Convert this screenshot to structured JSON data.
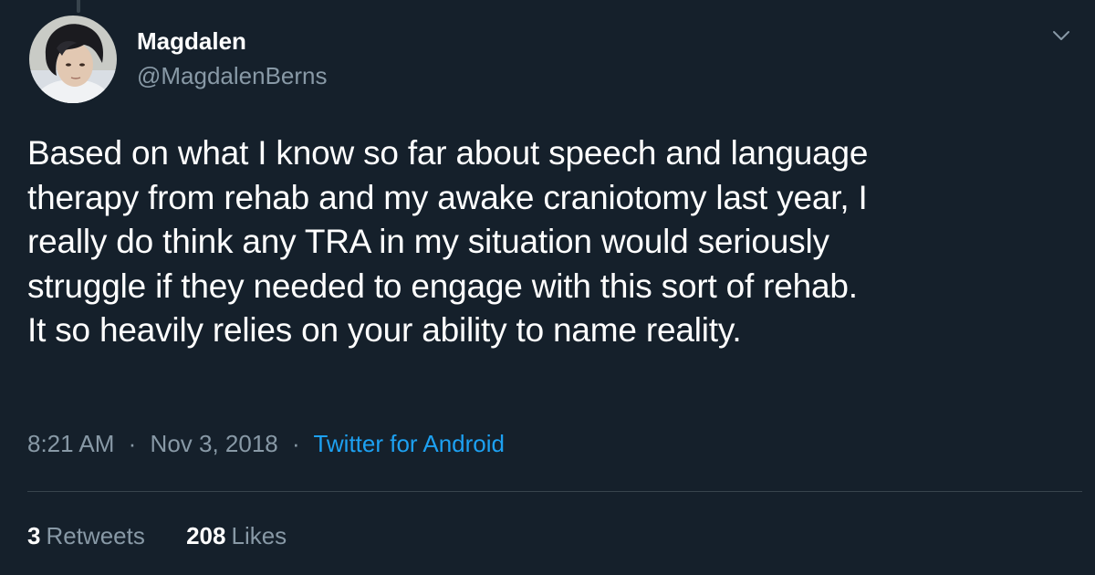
{
  "colors": {
    "background": "#15202b",
    "text_primary": "#ffffff",
    "text_secondary": "#8899a6",
    "accent": "#1da1f2",
    "divider": "#38444d"
  },
  "author": {
    "name": "Magdalen",
    "handle": "@MagdalenBerns",
    "avatar_icon": "avatar-photo"
  },
  "menu": {
    "icon": "chevron-down-icon"
  },
  "tweet": {
    "lines": [
      "Based on what I know so far about speech and language",
      "therapy from rehab and my awake craniotomy last year, I",
      "really do think any TRA in my situation would seriously",
      "struggle if they needed to engage with this sort of rehab.",
      "It so heavily relies on your ability to name reality."
    ]
  },
  "meta": {
    "time": "8:21 AM",
    "separator": "·",
    "date": "Nov 3, 2018",
    "source": "Twitter for Android"
  },
  "stats": {
    "retweets_count": "3",
    "retweets_label": "Retweets",
    "likes_count": "208",
    "likes_label": "Likes"
  }
}
